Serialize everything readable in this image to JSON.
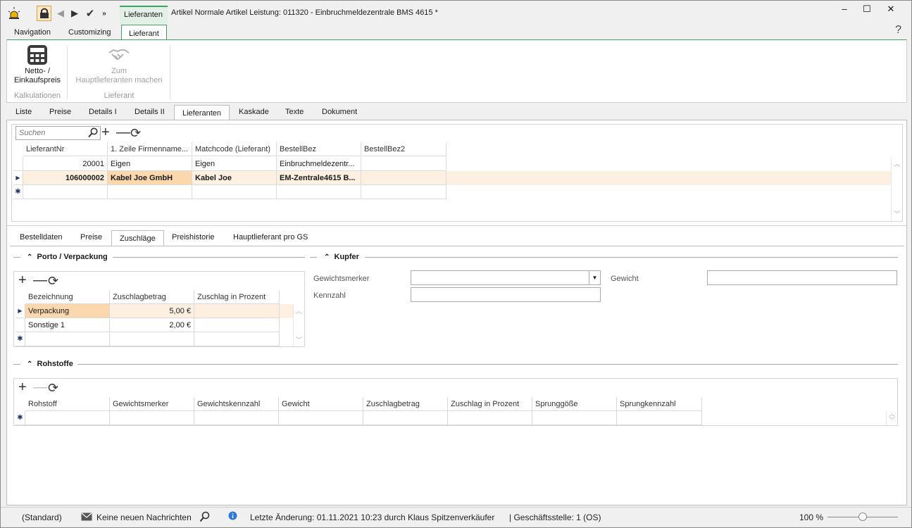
{
  "titlebar": {
    "context_tab": "Lieferanten",
    "title": "Artikel Normale Artikel Leistung: 011320 - Einbruchmeldezentrale BMS 4615 *",
    "qat_icons": [
      "siren-icon",
      "lock-icon",
      "back-icon",
      "forward-icon",
      "check-icon",
      "more-icon"
    ],
    "minimize": "‒",
    "maximize": "☐",
    "close": "✕"
  },
  "ribbon": {
    "tabs": [
      "Navigation",
      "Customizing",
      "Lieferant"
    ],
    "active_tab": "Lieferant",
    "help": "?",
    "buttons": [
      {
        "line1": "Netto- /",
        "line2": "Einkaufspreis",
        "icon": "calculator-icon",
        "enabled": true
      },
      {
        "line1": "Zum",
        "line2": "Hauptlieferanten machen",
        "icon": "handshake-icon",
        "enabled": false
      }
    ],
    "groups": [
      "Kalkulationen",
      "Lieferant"
    ]
  },
  "main_tabs": {
    "items": [
      "Liste",
      "Preise",
      "Details I",
      "Details II",
      "Lieferanten",
      "Kaskade",
      "Texte",
      "Dokument"
    ],
    "active": "Lieferanten"
  },
  "search": {
    "placeholder": "Suchen"
  },
  "lieferanten_grid": {
    "columns": [
      "LieferantNr",
      "1. Zeile Firmenname...",
      "Matchcode (Lieferant)",
      "BestellBez",
      "BestellBez2"
    ],
    "rows": [
      {
        "nr": "20001",
        "firma": "Eigen",
        "match": "Eigen",
        "bez": "Einbruchmeldezentr...",
        "bez2": ""
      },
      {
        "nr": "106000002",
        "firma": "Kabel Joe GmbH",
        "match": "Kabel Joe",
        "bez": "EM-Zentrale4615 B...",
        "bez2": ""
      }
    ]
  },
  "sub_tabs": {
    "items": [
      "Bestelldaten",
      "Preise",
      "Zuschläge",
      "Preishistorie",
      "Hauptlieferant pro GS"
    ],
    "active": "Zuschläge"
  },
  "porto": {
    "title": "Porto / Verpackung",
    "columns": [
      "Bezeichnung",
      "Zuschlagbetrag",
      "Zuschlag in Prozent"
    ],
    "rows": [
      {
        "bez": "Verpackung",
        "betrag": "5,00 €",
        "prozent": ""
      },
      {
        "bez": "Sonstige 1",
        "betrag": "2,00 €",
        "prozent": ""
      }
    ]
  },
  "kupfer": {
    "title": "Kupfer",
    "gewichtsmerker_label": "Gewichtsmerker",
    "gewicht_label": "Gewicht",
    "kennzahl_label": "Kennzahl",
    "gewichtsmerker_value": "",
    "gewicht_value": "",
    "kennzahl_value": ""
  },
  "rohstoffe": {
    "title": "Rohstoffe",
    "columns": [
      "Rohstoff",
      "Gewichtsmerker",
      "Gewichtskennzahl",
      "Gewicht",
      "Zuschlagbetrag",
      "Zuschlag in Prozent",
      "Sprunggöße",
      "Sprungkennzahl"
    ]
  },
  "statusbar": {
    "profile": "(Standard)",
    "messages": "Keine neuen Nachrichten",
    "last_change": "Letzte Änderung: 01.11.2021 10:23 durch Klaus Spitzenverkäufer",
    "branch": "| Geschäftsstelle:  1 (OS)",
    "zoom": "100 %",
    "zoom_level": 0.5
  },
  "colors": {
    "accent_green": "#3fa35f",
    "selected_row": "#fdf0e0",
    "selected_cell": "#fad7ad"
  }
}
